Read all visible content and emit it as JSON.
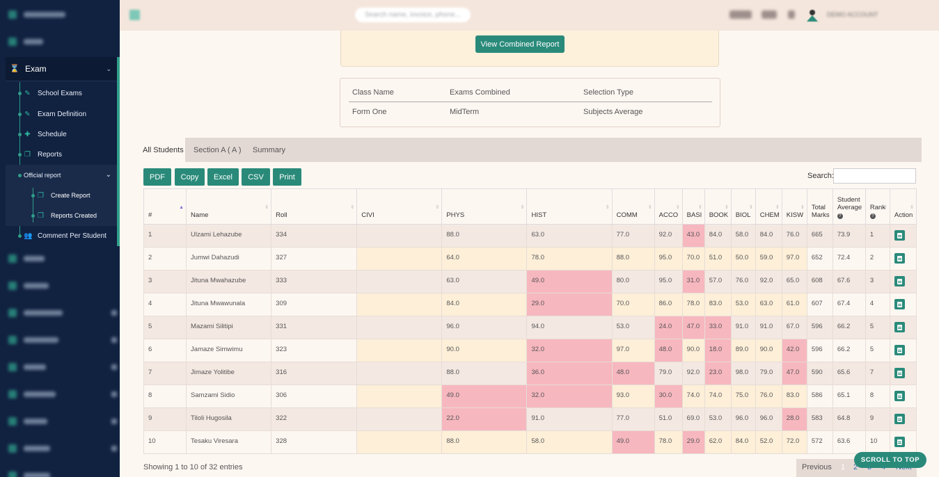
{
  "sidebar": {
    "exam_label": "Exam",
    "exam_items": [
      {
        "label": "School Exams"
      },
      {
        "label": "Exam Definition"
      },
      {
        "label": "Schedule"
      },
      {
        "label": "Reports"
      }
    ],
    "official_report": {
      "label": "Official report",
      "items": [
        {
          "label": "Create Report"
        },
        {
          "label": "Reports Created"
        }
      ]
    },
    "comment_item": "Comment Per Student"
  },
  "topbar": {
    "search_placeholder": "Search name, invoice, phone..."
  },
  "report": {
    "combined_button": "View Combined Report",
    "info_headers": [
      "Class Name",
      "Exams Combined",
      "Selection Type"
    ],
    "info_values": [
      "Form One",
      "MidTerm",
      "Subjects Average"
    ]
  },
  "tabs": [
    {
      "label": "All Students",
      "active": true
    },
    {
      "label": "Section A ( A )",
      "active": false
    },
    {
      "label": "Summary",
      "active": false
    }
  ],
  "export_buttons": [
    "PDF",
    "Copy",
    "Excel",
    "CSV",
    "Print"
  ],
  "search_label": "Search:",
  "table": {
    "headers": [
      "#",
      "Name",
      "Roll",
      "CIVI",
      "PHYS",
      "HIST",
      "COMM",
      "ACCO",
      "BASI",
      "BOOK",
      "BIOL",
      "CHEM",
      "KISW",
      "Total Marks",
      "Student Average",
      "Rank",
      "Action"
    ],
    "rows": [
      [
        "1",
        "Ulzami Lehazube",
        "334",
        "",
        "88.0",
        "63.0",
        "77.0",
        "92.0",
        "43.0",
        "84.0",
        "58.0",
        "84.0",
        "76.0",
        "665",
        "73.9",
        "1"
      ],
      [
        "2",
        "Jumwi Dahazudi",
        "327",
        "",
        "64.0",
        "78.0",
        "88.0",
        "95.0",
        "70.0",
        "51.0",
        "50.0",
        "59.0",
        "97.0",
        "652",
        "72.4",
        "2"
      ],
      [
        "3",
        "Jituna Mwahazube",
        "333",
        "",
        "63.0",
        "49.0",
        "80.0",
        "95.0",
        "31.0",
        "57.0",
        "76.0",
        "92.0",
        "65.0",
        "608",
        "67.6",
        "3"
      ],
      [
        "4",
        "Jituna Mwawunala",
        "309",
        "",
        "84.0",
        "29.0",
        "70.0",
        "86.0",
        "78.0",
        "83.0",
        "53.0",
        "63.0",
        "61.0",
        "607",
        "67.4",
        "4"
      ],
      [
        "5",
        "Mazami Silitipi",
        "331",
        "",
        "96.0",
        "94.0",
        "53.0",
        "24.0",
        "47.0",
        "33.0",
        "91.0",
        "91.0",
        "67.0",
        "596",
        "66.2",
        "5"
      ],
      [
        "6",
        "Jamaze Simwimu",
        "323",
        "",
        "90.0",
        "32.0",
        "97.0",
        "48.0",
        "90.0",
        "18.0",
        "89.0",
        "90.0",
        "42.0",
        "596",
        "66.2",
        "5"
      ],
      [
        "7",
        "Jimaze Yolitibe",
        "316",
        "",
        "88.0",
        "36.0",
        "48.0",
        "79.0",
        "92.0",
        "23.0",
        "98.0",
        "79.0",
        "47.0",
        "590",
        "65.6",
        "7"
      ],
      [
        "8",
        "Samzami Sidio",
        "306",
        "",
        "49.0",
        "32.0",
        "93.0",
        "30.0",
        "74.0",
        "74.0",
        "75.0",
        "76.0",
        "83.0",
        "586",
        "65.1",
        "8"
      ],
      [
        "9",
        "Tiloli Hugosila",
        "322",
        "",
        "22.0",
        "91.0",
        "77.0",
        "51.0",
        "69.0",
        "53.0",
        "96.0",
        "96.0",
        "28.0",
        "583",
        "64.8",
        "9"
      ],
      [
        "10",
        "Tesaku Viresara",
        "328",
        "",
        "88.0",
        "58.0",
        "49.0",
        "78.0",
        "29.0",
        "62.0",
        "84.0",
        "52.0",
        "72.0",
        "572",
        "63.6",
        "10"
      ]
    ]
  },
  "footer": {
    "showing": "Showing 1 to 10 of 32 entries",
    "prev": "Previous",
    "pages": [
      "1",
      "2",
      "3",
      "4"
    ],
    "next": "Next"
  },
  "scroll_top": "SCROLL TO TOP",
  "colors": {
    "accent": "#2a8a7a",
    "sidebar_bg": "#112140",
    "low_score": "#f7b7bf"
  }
}
